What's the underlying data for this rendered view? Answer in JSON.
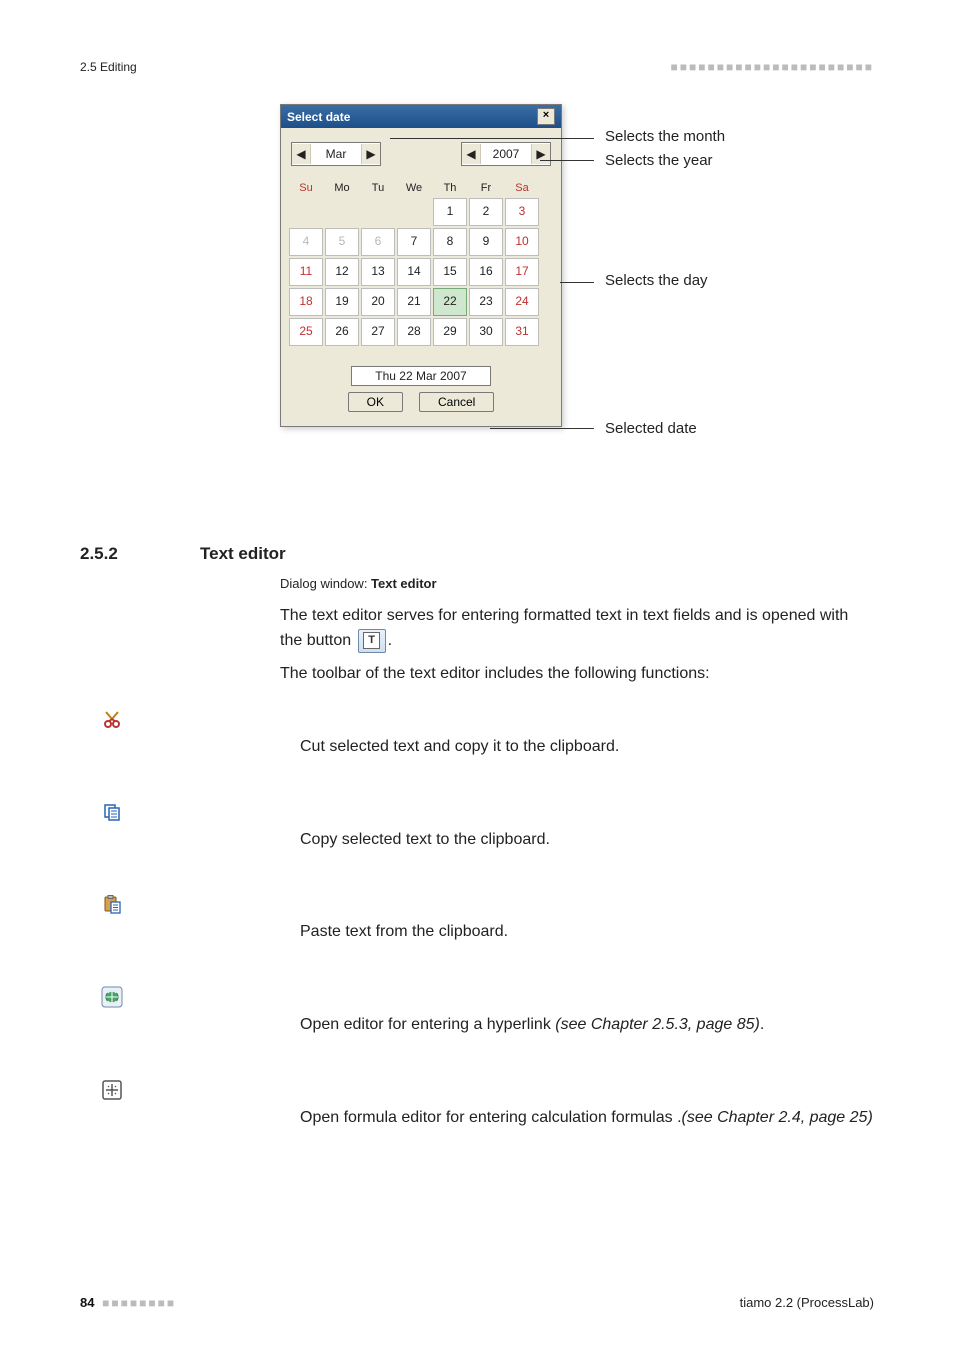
{
  "header": {
    "breadcrumb": "2.5 Editing",
    "decoration": "■■■■■■■■■■■■■■■■■■■■■■"
  },
  "figure": {
    "dialog_title": "Select date",
    "month_value": "Mar",
    "year_value": "2007",
    "weekdays": [
      "Su",
      "Mo",
      "Tu",
      "We",
      "Th",
      "Fr",
      "Sa"
    ],
    "rows": [
      [
        {
          "d": "",
          "other": true,
          "blank": true
        },
        {
          "d": "",
          "other": true,
          "blank": true
        },
        {
          "d": "",
          "other": true,
          "blank": true
        },
        {
          "d": "",
          "other": true,
          "blank": true
        },
        {
          "d": "1"
        },
        {
          "d": "2"
        },
        {
          "d": "3",
          "sat": true
        }
      ],
      [
        {
          "d": "4",
          "sun": true,
          "other": true
        },
        {
          "d": "5",
          "other": true
        },
        {
          "d": "6",
          "other": true
        },
        {
          "d": "7"
        },
        {
          "d": "8"
        },
        {
          "d": "9"
        },
        {
          "d": "10",
          "sat": true
        }
      ],
      [
        {
          "d": "11",
          "sun": true
        },
        {
          "d": "12"
        },
        {
          "d": "13"
        },
        {
          "d": "14"
        },
        {
          "d": "15"
        },
        {
          "d": "16"
        },
        {
          "d": "17",
          "sat": true
        }
      ],
      [
        {
          "d": "18",
          "sun": true
        },
        {
          "d": "19"
        },
        {
          "d": "20"
        },
        {
          "d": "21"
        },
        {
          "d": "22",
          "selected": true
        },
        {
          "d": "23"
        },
        {
          "d": "24",
          "sat": true
        }
      ],
      [
        {
          "d": "25",
          "sun": true
        },
        {
          "d": "26"
        },
        {
          "d": "27"
        },
        {
          "d": "28"
        },
        {
          "d": "29"
        },
        {
          "d": "30"
        },
        {
          "d": "31",
          "sat": true
        }
      ]
    ],
    "selected_date": "Thu  22 Mar 2007",
    "ok_label": "OK",
    "cancel_label": "Cancel",
    "callouts": {
      "month": "Selects the month",
      "year": "Selects the year",
      "day": "Selects the day",
      "selected": "Selected date"
    }
  },
  "section": {
    "number": "2.5.2",
    "title": "Text editor",
    "caption_prefix": "Dialog window: ",
    "caption_name": "Text editor",
    "para1_a": "The text editor serves for entering formatted text in text fields and is opened with the button ",
    "para1_b": ".",
    "para2": "The toolbar of the text editor includes the following functions:"
  },
  "tools": [
    {
      "icon": "cut",
      "text": "Cut selected text and copy it to the clipboard."
    },
    {
      "icon": "copy",
      "text": "Copy selected text to the clipboard."
    },
    {
      "icon": "paste",
      "text": "Paste text from the clipboard."
    },
    {
      "icon": "hyperlink",
      "text": "Open editor for entering a hyperlink ",
      "ref": "(see Chapter 2.5.3, page 85)",
      "suffix": "."
    },
    {
      "icon": "formula",
      "text": "Open formula editor for entering calculation formulas .",
      "ref": "(see Chapter 2.4, page 25)"
    }
  ],
  "footer": {
    "page": "84",
    "decoration": "■■■■■■■■",
    "product": "tiamo 2.2 (ProcessLab)"
  }
}
